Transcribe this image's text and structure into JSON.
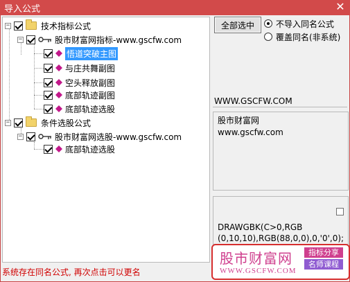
{
  "window": {
    "title": "导入公式",
    "close_glyph": "✕"
  },
  "tree": {
    "groups": [
      {
        "label": "技术指标公式",
        "checked": true,
        "source": {
          "label": "股市财富网指标-www.gscfw.com",
          "checked": true,
          "items": [
            {
              "label": "悟道突破主图",
              "checked": true,
              "selected": true
            },
            {
              "label": "与庄共舞副图",
              "checked": true
            },
            {
              "label": "空头释放副图",
              "checked": true
            },
            {
              "label": "底部轨迹副图",
              "checked": true
            },
            {
              "label": "底部轨迹选股",
              "checked": true
            }
          ]
        }
      },
      {
        "label": "条件选股公式",
        "checked": true,
        "source": {
          "label": "股市财富网选股-www.gscfw.com",
          "checked": true,
          "items": [
            {
              "label": "底部轨迹选股",
              "checked": true
            }
          ]
        }
      }
    ]
  },
  "status_message": "系统存在同名公式, 再次点击可以更名",
  "buttons": {
    "select_all": "全部选中"
  },
  "options": {
    "no_import_same_name": "不导入同名公式",
    "overwrite_same_name": "覆盖同名(非系统)",
    "selected": "no_import_same_name"
  },
  "info": {
    "url": "WWW.GSCFW.COM",
    "description_line1": "股市财富网",
    "description_line2": "www.gscfw.com",
    "code_line1": "DRAWGBK(C>0,RGB",
    "code_line2": "(0,10,10),RGB(88,0,0),0,'0',0);"
  },
  "logo": {
    "brand": "股市财富网",
    "domain": "WWW.GSCFW.COM",
    "tag1": "指标分享",
    "tag2": "名师课程"
  }
}
